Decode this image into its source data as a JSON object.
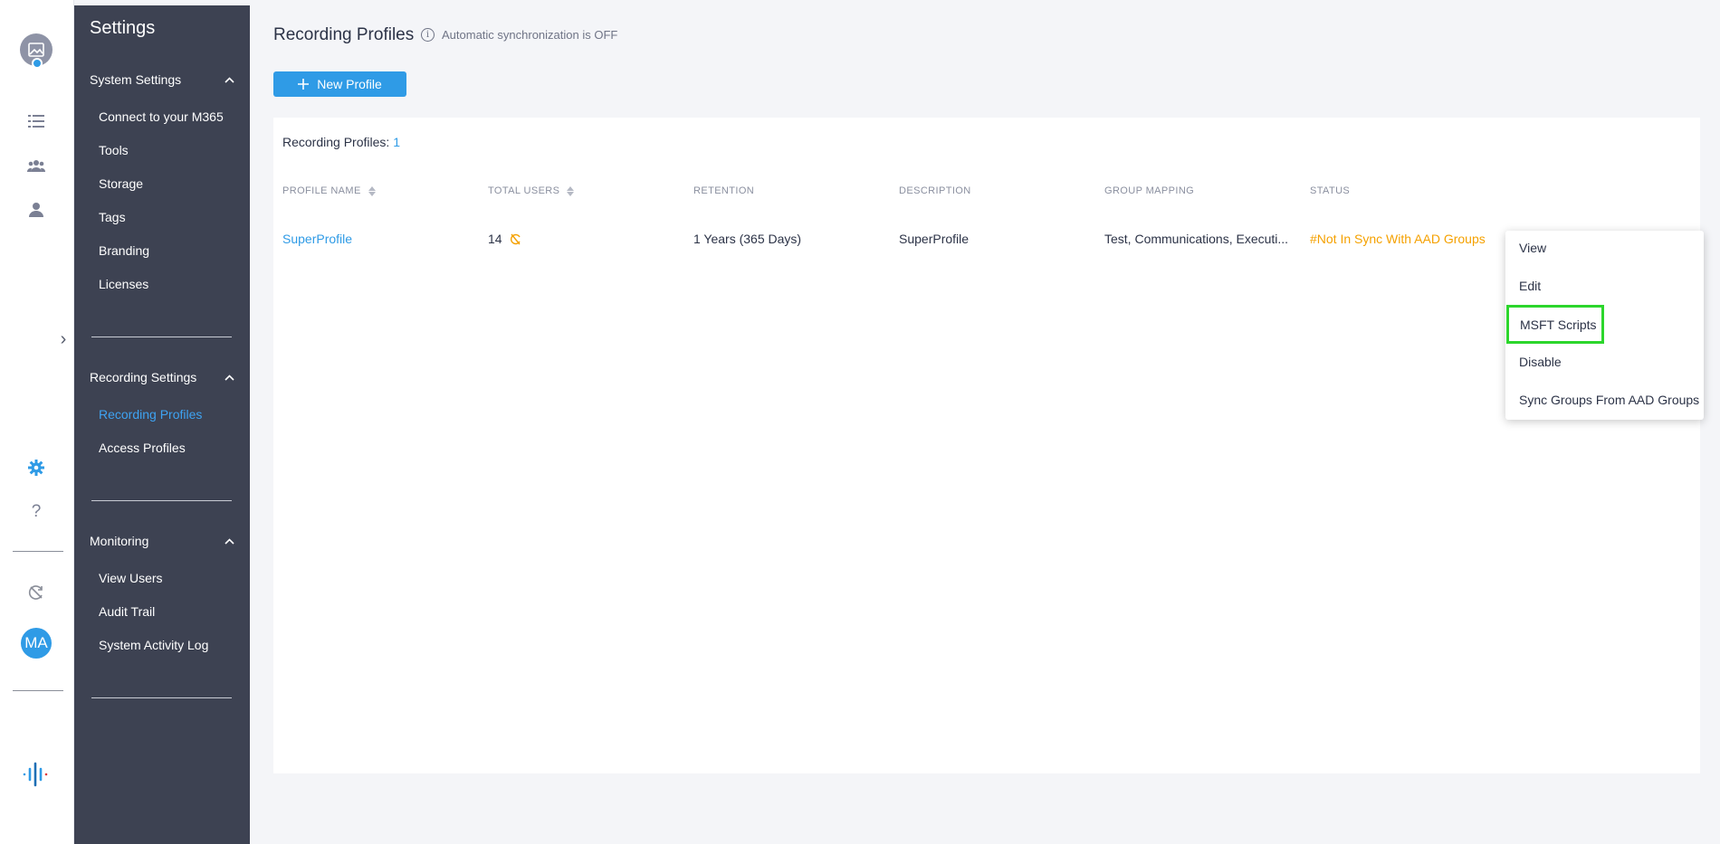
{
  "rail": {
    "icons": [
      "image-avatar-icon",
      "list-icon",
      "group-icon",
      "user-icon",
      "expand-chevron-icon",
      "gear-icon",
      "help-icon",
      "sync-off-icon",
      "logo-icon"
    ],
    "help_glyph": "?",
    "expand_glyph": "›",
    "user_initials": "MA",
    "accent_color": "#2f9be6"
  },
  "sidebar": {
    "title": "Settings",
    "sections": [
      {
        "label": "System Settings",
        "items": [
          "Connect to your M365",
          "Tools",
          "Storage",
          "Tags",
          "Branding",
          "Licenses"
        ]
      },
      {
        "label": "Recording Settings",
        "items": [
          "Recording Profiles",
          "Access Profiles"
        ]
      },
      {
        "label": "Monitoring",
        "items": [
          "View Users",
          "Audit Trail",
          "System Activity Log"
        ]
      }
    ],
    "active_item": "Recording Profiles",
    "bg_color": "#3d4252"
  },
  "header": {
    "title": "Recording Profiles",
    "sync_status": "Automatic synchronization is OFF",
    "new_button": "New Profile"
  },
  "table": {
    "count_label": "Recording Profiles:",
    "count_value": "1",
    "columns": [
      "PROFILE NAME",
      "TOTAL USERS",
      "RETENTION",
      "DESCRIPTION",
      "GROUP MAPPING",
      "STATUS"
    ],
    "rows": [
      {
        "profile_name": "SuperProfile",
        "total_users": "14",
        "retention": "1 Years (365 Days)",
        "description": "SuperProfile",
        "group_mapping": "Test, Communications, Executi...",
        "status": "#Not In Sync With AAD Groups"
      }
    ]
  },
  "context_menu": {
    "items": [
      "View",
      "Edit",
      "MSFT Scripts",
      "Disable",
      "Sync Groups From AAD Groups"
    ],
    "highlighted": "MSFT Scripts",
    "highlight_color": "#2cd62c"
  }
}
